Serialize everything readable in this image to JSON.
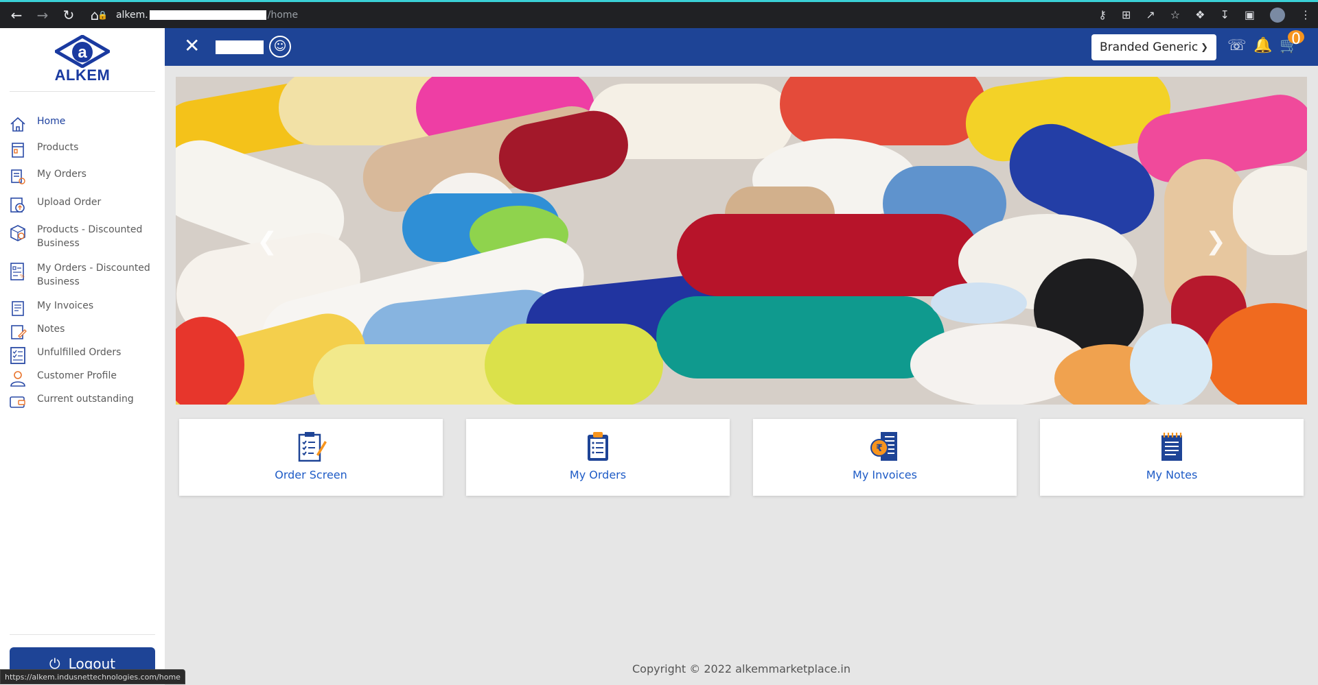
{
  "browser": {
    "url_host": "alkem.",
    "url_path": "/home",
    "status_url": "https://alkem.indusnettechnologies.com/home"
  },
  "sidebar": {
    "logo_text": "ALKEM",
    "items": [
      {
        "label": "Home",
        "icon": "home-icon"
      },
      {
        "label": "Products",
        "icon": "products-icon"
      },
      {
        "label": "My Orders",
        "icon": "orders-icon"
      },
      {
        "label": "Upload Order",
        "icon": "upload-icon"
      },
      {
        "label": "Products - Discounted Business",
        "icon": "discount-products-icon"
      },
      {
        "label": "My Orders - Discounted Business",
        "icon": "discount-orders-icon"
      },
      {
        "label": "My Invoices",
        "icon": "invoice-icon"
      },
      {
        "label": "Notes",
        "icon": "notes-icon"
      },
      {
        "label": "Unfulfilled Orders",
        "icon": "checklist-icon"
      },
      {
        "label": "Customer Profile",
        "icon": "user-icon"
      },
      {
        "label": "Current outstanding",
        "icon": "wallet-icon"
      }
    ],
    "logout_label": "Logout"
  },
  "header": {
    "brand_select_value": "Branded Generic",
    "cart_count": "0"
  },
  "cards": [
    {
      "label": "Order Screen",
      "icon": "clipboard-edit-icon"
    },
    {
      "label": "My Orders",
      "icon": "clipboard-list-icon"
    },
    {
      "label": "My Invoices",
      "icon": "rupee-receipt-icon"
    },
    {
      "label": "My Notes",
      "icon": "notepad-icon"
    }
  ],
  "footer": {
    "copyright": "Copyright © 2022 alkemmarketplace.in"
  },
  "colors": {
    "brand_blue": "#1e4496",
    "accent_orange": "#f7941d",
    "card_link": "#1e5bc6"
  }
}
